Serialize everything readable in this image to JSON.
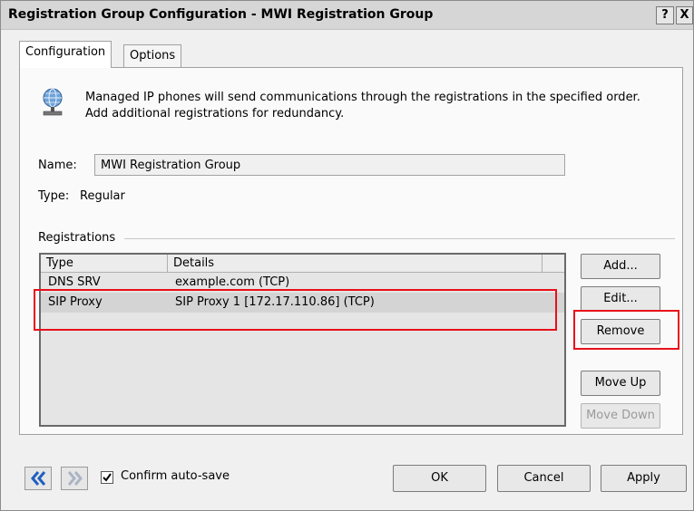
{
  "window": {
    "title": "Registration Group Configuration - MWI Registration Group",
    "help_label": "?",
    "close_label": "X"
  },
  "tabs": [
    {
      "label": "Configuration",
      "active": true
    },
    {
      "label": "Options",
      "active": false
    }
  ],
  "description": {
    "line1": "Managed IP phones will send communications through the registrations in the specified order.",
    "line2": "Add additional registrations for redundancy."
  },
  "name_field": {
    "label": "Name:",
    "value": "MWI Registration Group"
  },
  "type_field": {
    "label": "Type:",
    "value": "Regular"
  },
  "registrations": {
    "group_label": "Registrations",
    "columns": [
      "Type",
      "Details"
    ],
    "rows": [
      {
        "type": "DNS SRV",
        "details": "example.com (TCP)"
      },
      {
        "type": "SIP Proxy",
        "details": "SIP Proxy 1 [172.17.110.86] (TCP)",
        "selected": true
      }
    ]
  },
  "side_buttons": {
    "add": "Add...",
    "edit": "Edit...",
    "remove": "Remove",
    "move_up": "Move Up",
    "move_down": "Move Down"
  },
  "footer": {
    "confirm_autosave": {
      "label": "Confirm auto-save",
      "checked": true
    },
    "ok": "OK",
    "cancel": "Cancel",
    "apply": "Apply"
  },
  "colors": {
    "highlight": "#e8101a",
    "selected_row": "#d4d4d4",
    "nav_arrow": "#1f5fbf"
  }
}
